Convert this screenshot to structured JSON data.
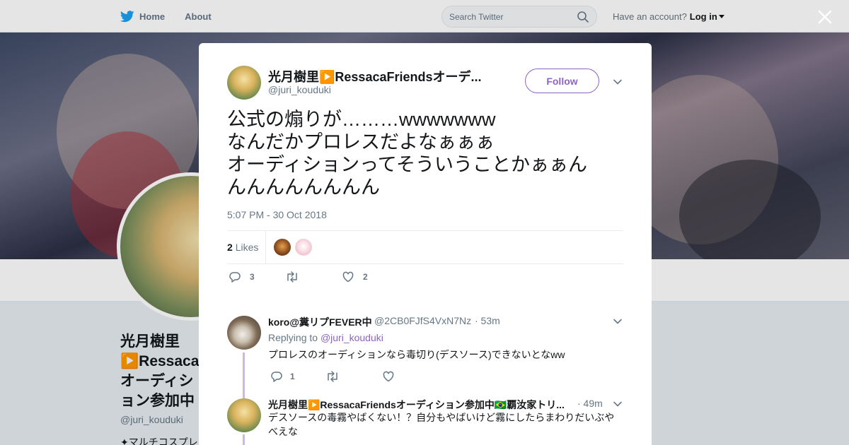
{
  "nav": {
    "home_label": "Home",
    "about_label": "About",
    "search_placeholder": "Search Twitter",
    "account_prompt": "Have an account?",
    "login_label": "Log in"
  },
  "profile": {
    "name": "光月樹里▶️RessacaFriendsオーディション参加中🇧🇷覇汝家トリカブト",
    "handle": "@juri_kouduki",
    "bio": "✦マルチコスプレイヤー"
  },
  "tweet": {
    "author_name": "光月樹里▶️RessacaFriendsオーデ...",
    "author_handle": "@juri_kouduki",
    "follow_label": "Follow",
    "text_lines": [
      "公式の煽りが………wwwwwww",
      "なんだかプロレスだよなぁぁぁ",
      "オーディションってそういうことかぁぁん",
      "んんんんんんんん"
    ],
    "timestamp": "5:07 PM - 30 Oct 2018",
    "likes_count": "2",
    "likes_label": "Likes",
    "reply_count": "3",
    "like_action_count": "2"
  },
  "replies": [
    {
      "name": "koro@糞リプFEVER中",
      "handle": "@2CB0FJfS4VxN7Nz",
      "time": "· 53m",
      "replying_to_label": "Replying to",
      "replying_to_handle": "@juri_kouduki",
      "text": "プロレスのオーディションなら毒切り(デスソース)できないとなww",
      "reply_count": "1"
    },
    {
      "name": "光月樹里▶️RessacaFriendsオーディション参加中🇧🇷覇汝家トリ...",
      "time": "· 49m",
      "text": "デスソースの毒霧やばくない！？自分もやばいけど霧にしたらまわりだいぶやべえな"
    }
  ],
  "colors": {
    "accent": "#8d64c3",
    "twitter_blue": "#1da1f2",
    "muted_text": "#657786",
    "thread_line": "#ccb8e3"
  }
}
